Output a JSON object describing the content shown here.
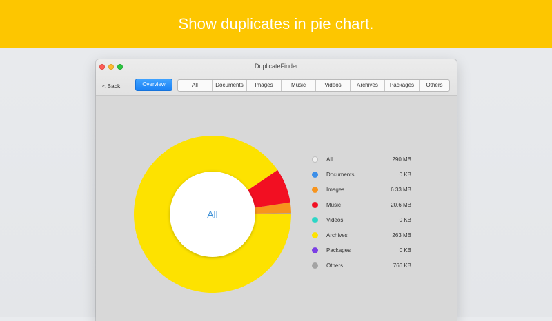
{
  "banner": {
    "text": "Show duplicates in pie chart."
  },
  "window": {
    "title": "DuplicateFinder"
  },
  "toolbar": {
    "back_label": "< Back",
    "overview_label": "Overview",
    "tabs": [
      "All",
      "Documents",
      "Images",
      "Music",
      "Videos",
      "Archives",
      "Packages",
      "Others"
    ]
  },
  "chart_data": {
    "type": "pie",
    "center_label": "All",
    "slices": [
      {
        "name": "All",
        "value_text": "290 MB",
        "mb": 290,
        "color": "#f2f2f2"
      },
      {
        "name": "Documents",
        "value_text": "0 KB",
        "mb": 0,
        "color": "#3b8ee8"
      },
      {
        "name": "Images",
        "value_text": "6.33 MB",
        "mb": 6.33,
        "color": "#f7941d"
      },
      {
        "name": "Music",
        "value_text": "20.6 MB",
        "mb": 20.6,
        "color": "#f20f22"
      },
      {
        "name": "Videos",
        "value_text": "0 KB",
        "mb": 0,
        "color": "#2cd6c6"
      },
      {
        "name": "Archives",
        "value_text": "263 MB",
        "mb": 263,
        "color": "#fde200"
      },
      {
        "name": "Packages",
        "value_text": "0 KB",
        "mb": 0,
        "color": "#7b3fe4"
      },
      {
        "name": "Others",
        "value_text": "766 KB",
        "mb": 0.766,
        "color": "#a3a3a3"
      }
    ]
  }
}
